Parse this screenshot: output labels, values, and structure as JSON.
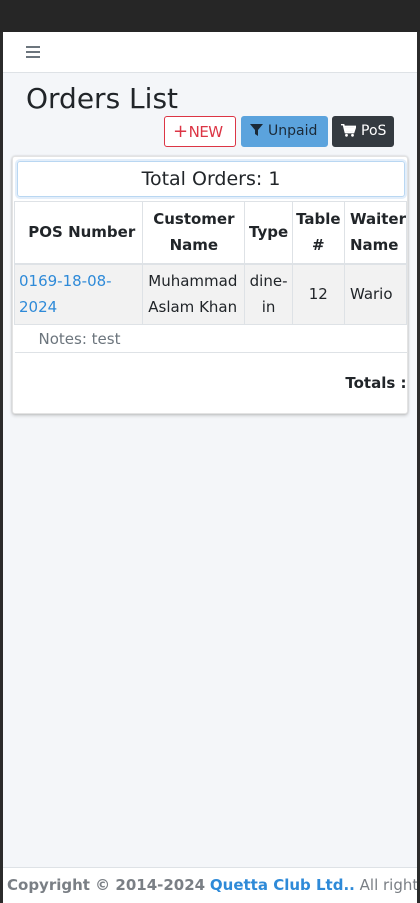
{
  "navbar": {
    "menu_icon": "hamburger-icon"
  },
  "page": {
    "title": "Orders List"
  },
  "toolbar": {
    "new_plus": "+",
    "new_label": "NEW",
    "unpaid_label": "Unpaid",
    "unpaid_icon": "filter-icon",
    "pos_label": "PoS",
    "pos_icon": "cart-icon"
  },
  "summary": {
    "total_orders": "Total Orders: 1"
  },
  "table": {
    "headers": {
      "pos_number": "POS Number",
      "customer_name_1": "Customer",
      "customer_name_2": "Name",
      "type": "Type",
      "table_1": "Table",
      "table_2": "#",
      "waiter_1": "Waiter",
      "waiter_2": "Name"
    },
    "rows": [
      {
        "pos_number": "0169-18-08-2024",
        "customer_1": "Muhammad",
        "customer_2": "Aslam Khan",
        "type_1": "dine-",
        "type_2": "in",
        "table": "12",
        "waiter": "Wario",
        "notes": "Notes: test"
      }
    ],
    "totals_label": "Totals :"
  },
  "footer": {
    "copyright": "Copyright © 2014-2024",
    "brand": "Quetta Club Ltd..",
    "rights": "All rights"
  },
  "colors": {
    "primary_link": "#2e8ad8",
    "danger": "#dc3545",
    "info_button": "#5ba3dd",
    "dark_button": "#343a40"
  }
}
